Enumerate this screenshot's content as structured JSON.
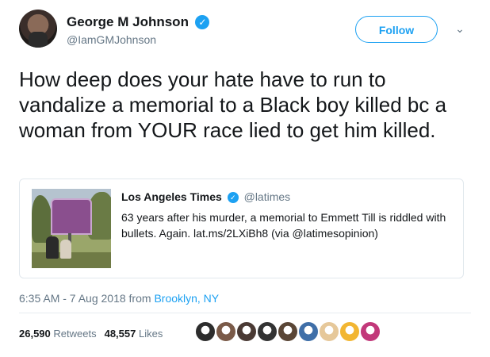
{
  "author": {
    "name": "George M Johnson",
    "handle": "@IamGMJohnson",
    "verified_mark": "✓"
  },
  "follow_button": {
    "label": "Follow"
  },
  "menu": {
    "chevron": "⌄"
  },
  "tweet": {
    "text": "How deep does your hate have to run to vandalize a memorial to a Black boy killed bc a woman from YOUR race lied to get him killed."
  },
  "quoted": {
    "name": "Los Angeles Times",
    "handle": "@latimes",
    "verified_mark": "✓",
    "text": "63 years after his murder, a memorial to Emmett Till is riddled with bullets. Again. lat.ms/2LXiBh8 (via @latimesopinion)"
  },
  "meta": {
    "time": "6:35 AM - 7 Aug 2018 from ",
    "location": "Brooklyn, NY"
  },
  "stats": {
    "retweets_count": "26,590",
    "retweets_label": "Retweets",
    "likes_count": "48,557",
    "likes_label": "Likes"
  },
  "liker_avatars": [
    {
      "name": "liker-avatar-1",
      "color": "#2d2d2d"
    },
    {
      "name": "liker-avatar-2",
      "color": "#7a5a48"
    },
    {
      "name": "liker-avatar-3",
      "color": "#4a3a34"
    },
    {
      "name": "liker-avatar-4",
      "color": "#333333"
    },
    {
      "name": "liker-avatar-5",
      "color": "#5a4636"
    },
    {
      "name": "liker-avatar-6",
      "color": "#3f6fa8"
    },
    {
      "name": "liker-avatar-7",
      "color": "#e6c89a"
    },
    {
      "name": "liker-avatar-8",
      "color": "#f2b632"
    },
    {
      "name": "liker-avatar-9",
      "color": "#c2387a"
    }
  ],
  "colors": {
    "accent": "#1da1f2",
    "muted": "#657786",
    "text": "#14171a"
  }
}
